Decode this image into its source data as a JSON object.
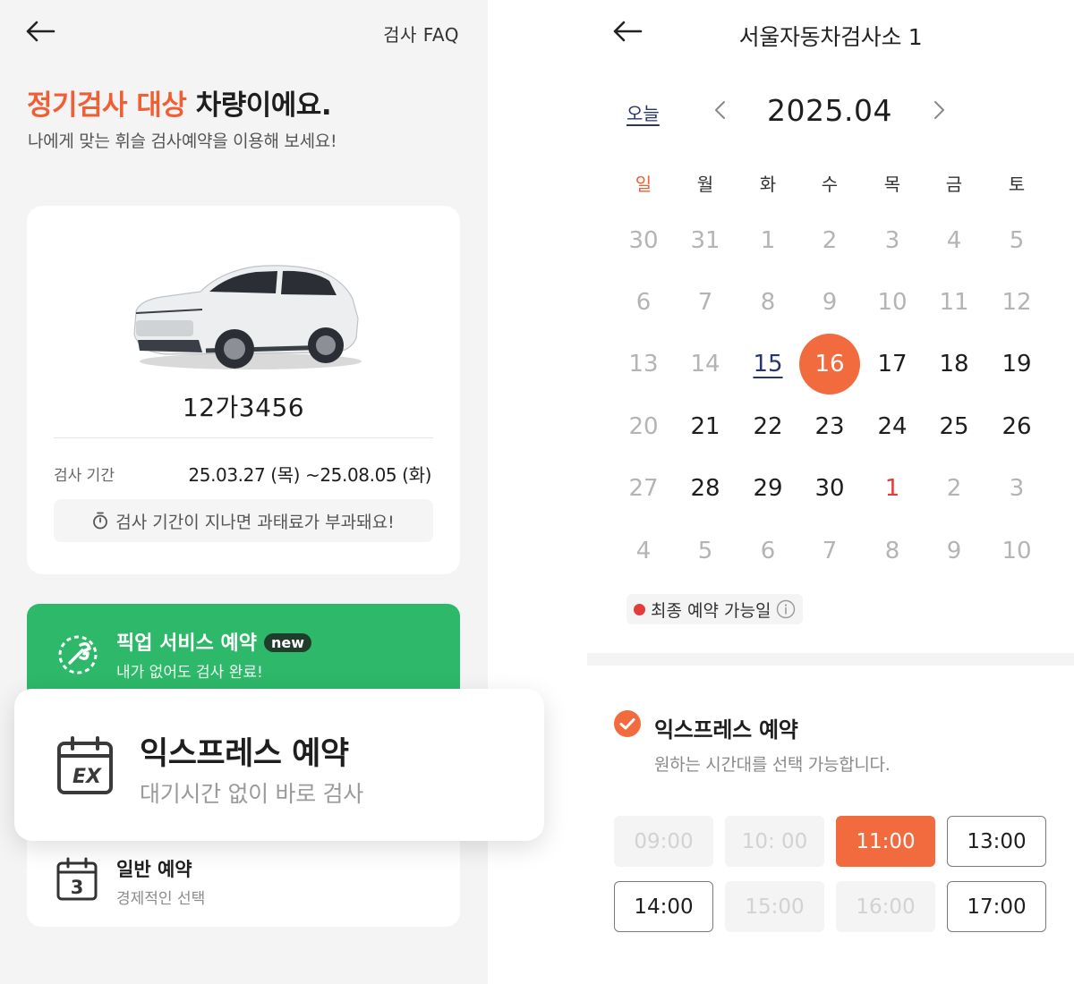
{
  "left": {
    "header": {
      "faq_label": "검사 FAQ"
    },
    "headline_highlight": "정기검사 대상",
    "headline_rest": " 차량이에요.",
    "subline": "나에게 맞는 휘슬 검사예약을 이용해 보세요!",
    "vehicle": {
      "plate": "12가3456",
      "period_label": "검사 기간",
      "period_value": "25.03.27 (목) ~25.08.05 (화)",
      "warning": "검사 기간이 지나면 과태료가 부과돼요!"
    },
    "pickup": {
      "title": "픽업 서비스 예약",
      "badge": "new",
      "subtitle": "내가 없어도 검사 완료!"
    },
    "express": {
      "title": "익스프레스 예약",
      "subtitle": "대기시간 없이 바로 검사",
      "icon_text": "EX"
    },
    "normal": {
      "title": "일반 예약",
      "subtitle": "경제적인 선택",
      "icon_text": "3"
    }
  },
  "right": {
    "header": {
      "title": "서울자동차검사소 1"
    },
    "calendar": {
      "today_label": "오늘",
      "month": "2025.04",
      "weekdays": [
        "일",
        "월",
        "화",
        "수",
        "목",
        "금",
        "토"
      ],
      "weeks": [
        [
          {
            "d": "30",
            "s": "muted"
          },
          {
            "d": "31",
            "s": "muted"
          },
          {
            "d": "1",
            "s": "muted"
          },
          {
            "d": "2",
            "s": "muted"
          },
          {
            "d": "3",
            "s": "muted"
          },
          {
            "d": "4",
            "s": "muted"
          },
          {
            "d": "5",
            "s": "muted"
          }
        ],
        [
          {
            "d": "6",
            "s": "muted"
          },
          {
            "d": "7",
            "s": "muted"
          },
          {
            "d": "8",
            "s": "muted"
          },
          {
            "d": "9",
            "s": "muted"
          },
          {
            "d": "10",
            "s": "muted"
          },
          {
            "d": "11",
            "s": "muted"
          },
          {
            "d": "12",
            "s": "muted"
          }
        ],
        [
          {
            "d": "13",
            "s": "muted"
          },
          {
            "d": "14",
            "s": "muted"
          },
          {
            "d": "15",
            "s": "today"
          },
          {
            "d": "16",
            "s": "selected"
          },
          {
            "d": "17",
            "s": "normal"
          },
          {
            "d": "18",
            "s": "normal"
          },
          {
            "d": "19",
            "s": "normal"
          }
        ],
        [
          {
            "d": "20",
            "s": "muted"
          },
          {
            "d": "21",
            "s": "normal"
          },
          {
            "d": "22",
            "s": "normal"
          },
          {
            "d": "23",
            "s": "normal"
          },
          {
            "d": "24",
            "s": "normal"
          },
          {
            "d": "25",
            "s": "normal"
          },
          {
            "d": "26",
            "s": "normal"
          }
        ],
        [
          {
            "d": "27",
            "s": "muted"
          },
          {
            "d": "28",
            "s": "normal"
          },
          {
            "d": "29",
            "s": "normal"
          },
          {
            "d": "30",
            "s": "normal"
          },
          {
            "d": "1",
            "s": "red"
          },
          {
            "d": "2",
            "s": "muted"
          },
          {
            "d": "3",
            "s": "muted"
          }
        ],
        [
          {
            "d": "4",
            "s": "muted"
          },
          {
            "d": "5",
            "s": "muted"
          },
          {
            "d": "6",
            "s": "muted"
          },
          {
            "d": "7",
            "s": "muted"
          },
          {
            "d": "8",
            "s": "muted"
          },
          {
            "d": "9",
            "s": "muted"
          },
          {
            "d": "10",
            "s": "muted"
          }
        ]
      ],
      "legend": "최종 예약 가능일"
    },
    "option": {
      "title": "익스프레스 예약",
      "subtitle": "원하는 시간대를 선택 가능합니다."
    },
    "time_slots": [
      {
        "label": "09:00",
        "state": "disabled"
      },
      {
        "label": "10: 00",
        "state": "disabled"
      },
      {
        "label": "11:00",
        "state": "selected"
      },
      {
        "label": "13:00",
        "state": "available"
      },
      {
        "label": "14:00",
        "state": "available"
      },
      {
        "label": "15:00",
        "state": "disabled"
      },
      {
        "label": "16:00",
        "state": "disabled"
      },
      {
        "label": "17:00",
        "state": "available"
      }
    ]
  },
  "colors": {
    "accent": "#f05f34",
    "selected": "#f26b3f",
    "pickup_green": "#2eb869",
    "today_navy": "#27356b",
    "red_day": "#e43b3b"
  },
  "icons": [
    "back-arrow-icon",
    "car-image",
    "timer-icon",
    "pickup-wrench-icon",
    "express-calendar-icon",
    "calendar-3-icon",
    "chevron-left-icon",
    "chevron-right-icon",
    "info-icon",
    "check-circle-icon"
  ]
}
